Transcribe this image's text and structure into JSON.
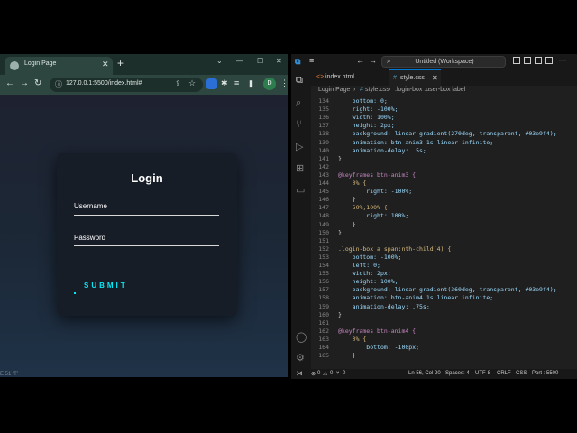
{
  "browser": {
    "tab_title": "Login Page",
    "url": "127.0.0.1:5500/index.html#",
    "avatar_letter": "D",
    "footer_text": "E 51 'T'"
  },
  "login": {
    "title": "Login",
    "username_label": "Username",
    "password_label": "Password",
    "submit_label": "SUBMIT"
  },
  "vscode": {
    "search_text": "Untitled (Workspace)",
    "tabs": [
      {
        "label": "index.html",
        "icon": "<>"
      },
      {
        "label": "style.css",
        "icon": "#"
      }
    ],
    "breadcrumbs": [
      "Login Page",
      "#",
      "style.css",
      ".login-box .user-box label"
    ],
    "code_lines": [
      {
        "n": "134",
        "text": "    bottom: 0;"
      },
      {
        "n": "135",
        "text": "    right: -100%;"
      },
      {
        "n": "136",
        "text": "    width: 100%;"
      },
      {
        "n": "137",
        "text": "    height: 2px;"
      },
      {
        "n": "138",
        "text": "    background: linear-gradient(270deg, transparent, #03e9f4);"
      },
      {
        "n": "139",
        "text": "    animation: btn-anim3 1s linear infinite;"
      },
      {
        "n": "140",
        "text": "    animation-delay: .5s;"
      },
      {
        "n": "141",
        "text": "}"
      },
      {
        "n": "142",
        "text": ""
      },
      {
        "n": "143",
        "text": "@keyframes btn-anim3 {"
      },
      {
        "n": "144",
        "text": "    0% {"
      },
      {
        "n": "145",
        "text": "        right: -100%;"
      },
      {
        "n": "146",
        "text": "    }"
      },
      {
        "n": "147",
        "text": "    50%,100% {"
      },
      {
        "n": "148",
        "text": "        right: 100%;"
      },
      {
        "n": "149",
        "text": "    }"
      },
      {
        "n": "150",
        "text": "}"
      },
      {
        "n": "151",
        "text": ""
      },
      {
        "n": "152",
        "text": ".login-box a span:nth-child(4) {"
      },
      {
        "n": "153",
        "text": "    bottom: -100%;"
      },
      {
        "n": "154",
        "text": "    left: 0;"
      },
      {
        "n": "155",
        "text": "    width: 2px;"
      },
      {
        "n": "156",
        "text": "    height: 100%;"
      },
      {
        "n": "157",
        "text": "    background: linear-gradient(360deg, transparent, #03e9f4);"
      },
      {
        "n": "158",
        "text": "    animation: btn-anim4 1s linear infinite;"
      },
      {
        "n": "159",
        "text": "    animation-delay: .75s;"
      },
      {
        "n": "160",
        "text": "}"
      },
      {
        "n": "161",
        "text": ""
      },
      {
        "n": "162",
        "text": "@keyframes btn-anim4 {"
      },
      {
        "n": "163",
        "text": "    0% {"
      },
      {
        "n": "164",
        "text": "        bottom: -100px;"
      },
      {
        "n": "165",
        "text": "    }"
      }
    ],
    "status": {
      "errors": "0",
      "warnings": "0",
      "ports": "0",
      "position": "Ln 56, Col 20",
      "spaces": "Spaces: 4",
      "encoding": "UTF-8",
      "eol": "CRLF",
      "language": "CSS",
      "port": "Port : 5500"
    }
  },
  "colors": {
    "accent_cyan": "#03e9f4",
    "vscode_blue": "#0078d4"
  }
}
